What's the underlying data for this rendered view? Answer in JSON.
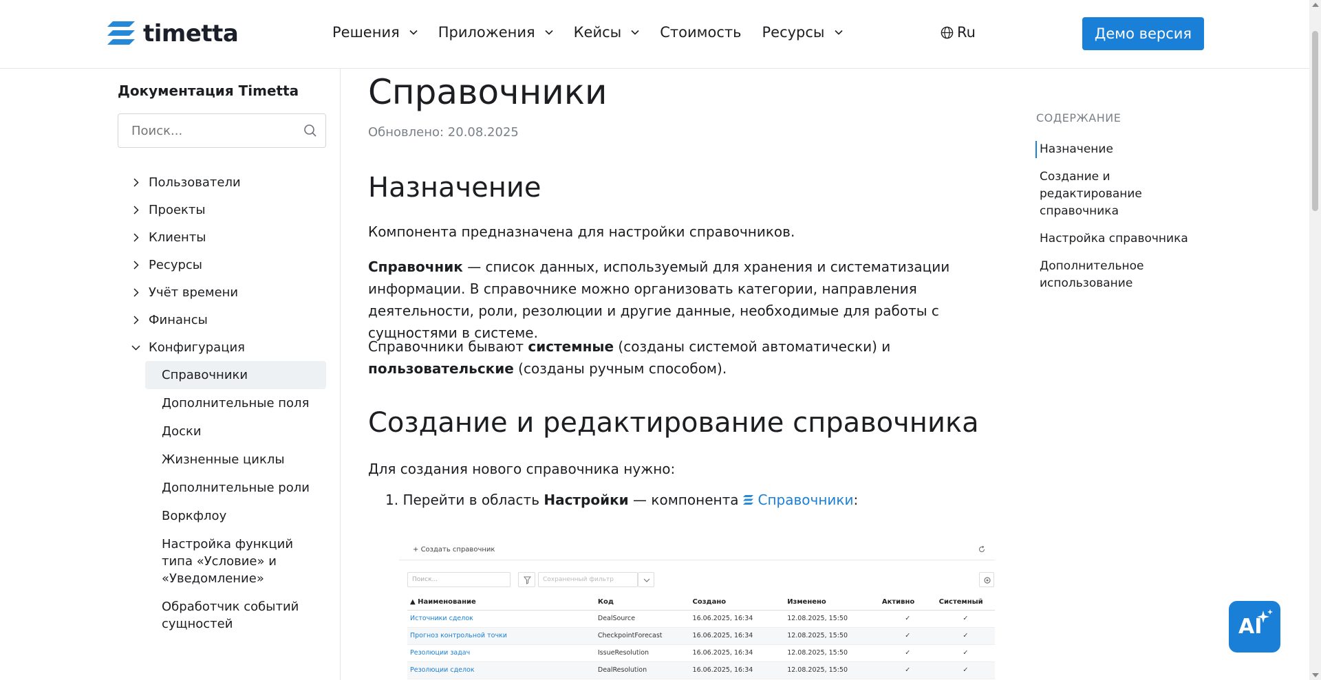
{
  "header": {
    "logo_text": "timetta",
    "nav": [
      {
        "label": "Решения",
        "has_dropdown": true
      },
      {
        "label": "Приложения",
        "has_dropdown": true
      },
      {
        "label": "Кейсы",
        "has_dropdown": true
      },
      {
        "label": "Стоимость",
        "has_dropdown": false
      },
      {
        "label": "Ресурсы",
        "has_dropdown": true
      }
    ],
    "lang": "Ru",
    "demo_label": "Демо версия",
    "accent_color": "#1a7fd6"
  },
  "sidebar": {
    "title": "Документация Timetta",
    "search_placeholder": "Поиск...",
    "items": [
      {
        "label": "Пользователи"
      },
      {
        "label": "Проекты"
      },
      {
        "label": "Клиенты"
      },
      {
        "label": "Ресурсы"
      },
      {
        "label": "Учёт времени"
      },
      {
        "label": "Финансы"
      },
      {
        "label": "Конфигурация"
      }
    ],
    "subitems": [
      {
        "label": "Справочники"
      },
      {
        "label": "Дополнительные поля"
      },
      {
        "label": "Доски"
      },
      {
        "label": "Жизненные циклы"
      },
      {
        "label": "Дополнительные роли"
      },
      {
        "label": "Воркфлоу"
      },
      {
        "label": "Настройка функций типа «Условие» и «Уведомление»"
      },
      {
        "label": "Обработчик событий сущностей"
      }
    ]
  },
  "main": {
    "title": "Справочники",
    "updated": "Обновлено: 20.08.2025",
    "section1_title": "Назначение",
    "p1": "Компонента предназначена для настройки справочников.",
    "p2_bold": "Справочник",
    "p2_rest": " — список данных, используемый для хранения и систематизации информации. В справочнике можно организовать категории, направления деятельности, роли, резолюции и другие данные, необходимые для работы с сущностями в системе.",
    "p3_a": "Справочники бывают ",
    "p3_b1": "системные",
    "p3_c": " (созданы системой автоматически) и ",
    "p3_b2": "пользовательские",
    "p3_d": " (созданы ручным способом).",
    "section2_title": "Создание и редактирование справочника",
    "p4": "Для создания нового справочника нужно:",
    "step1_a": "1. Перейти в область ",
    "step1_b": "Настройки",
    "step1_c": " — компонента",
    "step1_link": "Справочники",
    "step1_end": ":"
  },
  "screenshot": {
    "create_label": "Создать справочник",
    "search_placeholder": "Поиск...",
    "saved_filter_placeholder": "Сохраненный фильтр",
    "columns": [
      "▲ Наименование",
      "Код",
      "Создано",
      "Изменено",
      "Активно",
      "Системный"
    ],
    "rows": [
      {
        "name": "Источники сделок",
        "code": "DealSource",
        "created": "16.06.2025, 16:34",
        "modified": "12.08.2025, 15:50",
        "active": "✓",
        "system": "✓"
      },
      {
        "name": "Прогноз контрольной точки",
        "code": "CheckpointForecast",
        "created": "16.06.2025, 16:34",
        "modified": "12.08.2025, 15:50",
        "active": "✓",
        "system": "✓"
      },
      {
        "name": "Резолюции задач",
        "code": "IssueResolution",
        "created": "16.06.2025, 16:34",
        "modified": "12.08.2025, 15:50",
        "active": "✓",
        "system": "✓"
      },
      {
        "name": "Резолюции сделок",
        "code": "DealResolution",
        "created": "16.06.2025, 16:34",
        "modified": "12.08.2025, 15:50",
        "active": "✓",
        "system": "✓"
      }
    ]
  },
  "toc": {
    "title": "СОДЕРЖАНИЕ",
    "items": [
      {
        "label": "Назначение"
      },
      {
        "label": "Создание и редактирование справочника"
      },
      {
        "label": "Настройка справочника"
      },
      {
        "label": "Дополнительное использование"
      }
    ]
  },
  "ai_button": {
    "label": "AI",
    "icon": "sparkle-icon"
  }
}
